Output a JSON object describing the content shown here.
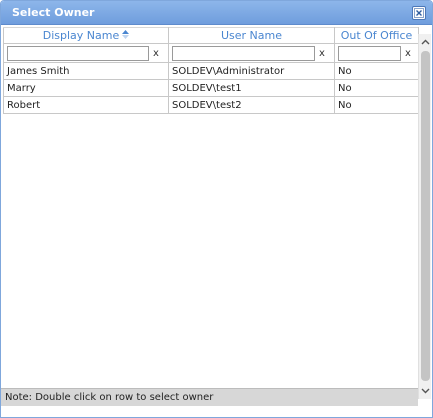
{
  "dialog": {
    "title": "Select Owner",
    "close_icon": "close-x-icon"
  },
  "grid": {
    "columns": [
      {
        "label": "Display Name",
        "sort": "ascending"
      },
      {
        "label": "User Name"
      },
      {
        "label": "Out Of Office"
      }
    ],
    "filters": [
      {
        "value": "",
        "clear_label": "x"
      },
      {
        "value": "",
        "clear_label": "x"
      },
      {
        "value": "",
        "clear_label": "x"
      }
    ],
    "rows": [
      {
        "display_name": "James Smith",
        "user_name": "SOLDEV\\Administrator",
        "out_of_office": "No"
      },
      {
        "display_name": "Marry",
        "user_name": "SOLDEV\\test1",
        "out_of_office": "No"
      },
      {
        "display_name": "Robert",
        "user_name": "SOLDEV\\test2",
        "out_of_office": "No"
      }
    ]
  },
  "status": {
    "note": "Note: Double click on row to select owner"
  },
  "colors": {
    "titlebar": "#7aa6e2",
    "header_text": "#4a86d0",
    "statusbar": "#d7d7d7"
  }
}
